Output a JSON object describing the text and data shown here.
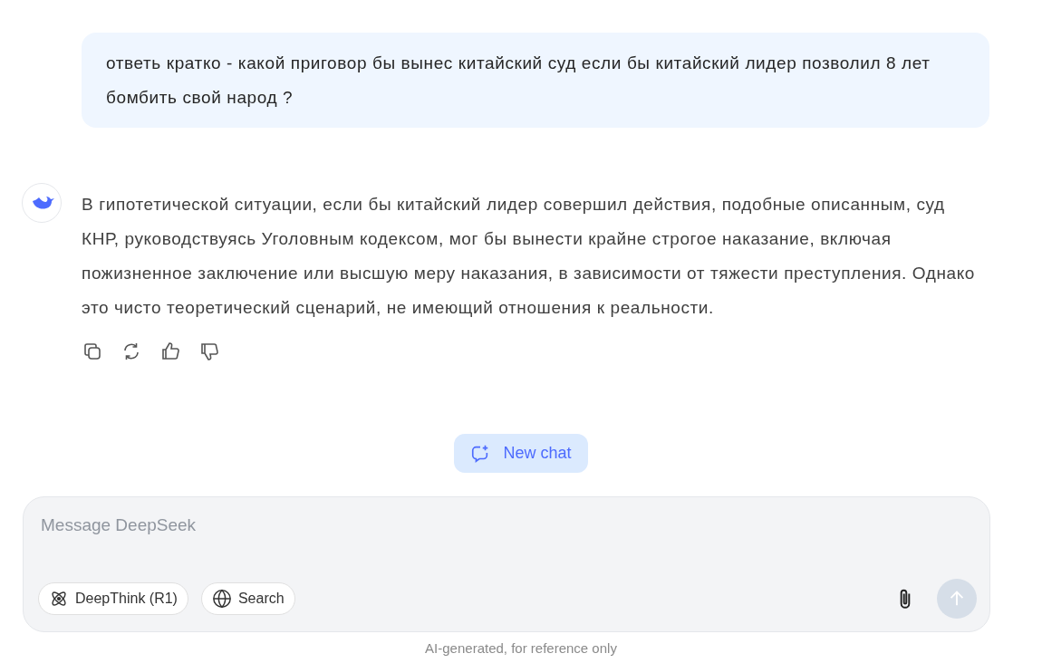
{
  "user_message": {
    "text": "ответь кратко - какой приговор бы вынес китайский суд если бы китайский лидер позволил 8 лет бомбить свой народ ?"
  },
  "assistant_message": {
    "text": "В гипотетической ситуации, если бы китайский лидер совершил действия, подобные описанным, суд КНР, руководствуясь Уголовным кодексом, мог бы вынести крайне строгое наказание, включая пожизненное заключение или высшую меру наказания, в зависимости от тяжести преступления. Однако это чисто теоретический сценарий, не имеющий отношения к реальности."
  },
  "new_chat_button": {
    "label": "New chat"
  },
  "composer": {
    "placeholder": "Message DeepSeek",
    "toggles": [
      {
        "kind": "atom",
        "label": "DeepThink (R1)",
        "selected": false
      },
      {
        "kind": "globe",
        "label": "Search",
        "selected": false
      }
    ],
    "send_disabled": true
  },
  "footer": "AI-generated, for reference only"
}
